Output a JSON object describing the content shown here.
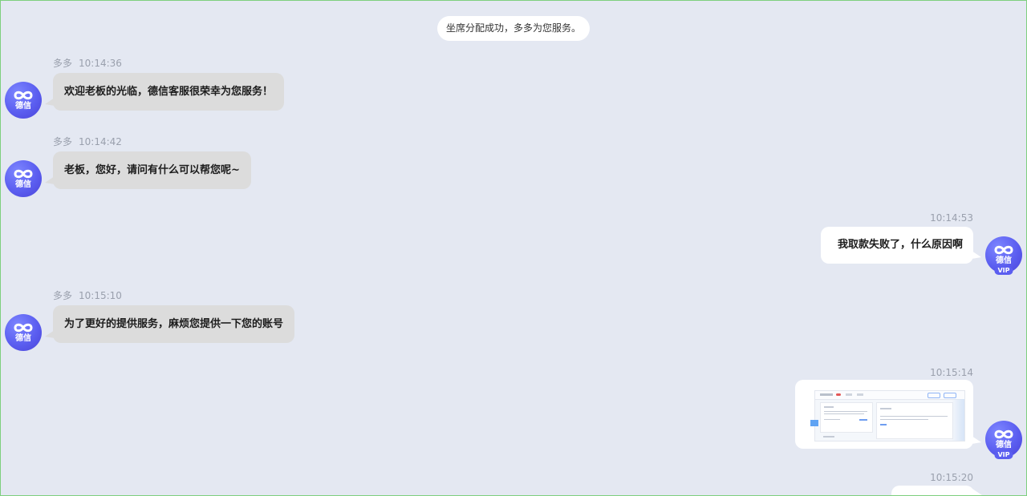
{
  "system_notice": "坐席分配成功，多多为您服务。",
  "agent": {
    "name": "多多",
    "avatar_icon": "dexin-infinity-logo-icon",
    "avatar_text": "德信"
  },
  "user": {
    "avatar_icon": "dexin-infinity-logo-icon",
    "avatar_text": "德信",
    "badge": "VIP"
  },
  "messages": [
    {
      "side": "agent",
      "sender": "多多",
      "time": "10:14:36",
      "text": "欢迎老板的光临，德信客服很荣幸为您服务！"
    },
    {
      "side": "agent",
      "sender": "多多",
      "time": "10:14:42",
      "text": "老板，您好，请问有什么可以帮您呢~"
    },
    {
      "side": "user",
      "time": "10:14:53",
      "text": "我取款失败了，什么原因啊"
    },
    {
      "side": "agent",
      "sender": "多多",
      "time": "10:15:10",
      "text": "为了更好的提供服务，麻烦您提供一下您的账号"
    },
    {
      "side": "user",
      "time": "10:15:14",
      "type": "image"
    },
    {
      "side": "user",
      "time": "10:15:20",
      "text": ""
    }
  ],
  "colors": {
    "background": "#e4e8f2",
    "agent_bubble": "#dcdcdc",
    "user_bubble": "#ffffff",
    "avatar": "#5b5ef0"
  }
}
